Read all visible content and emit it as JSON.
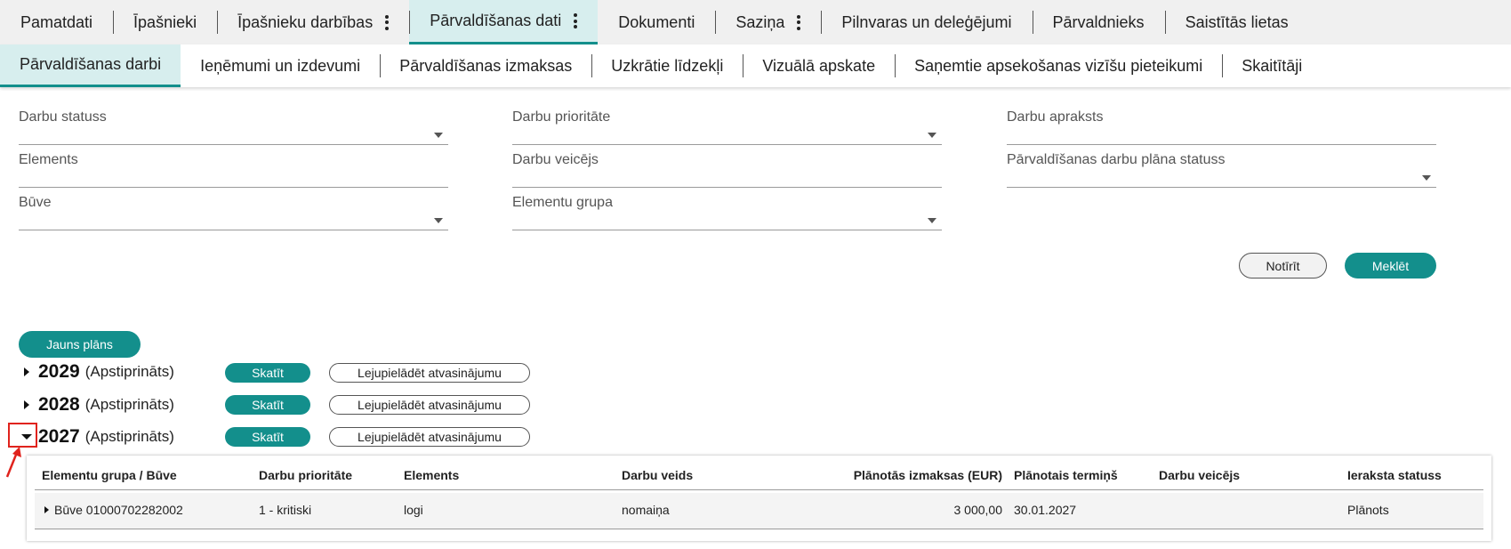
{
  "top_tabs": [
    {
      "label": "Pamatdati",
      "menu": false,
      "active": false
    },
    {
      "label": "Īpašnieki",
      "menu": false,
      "active": false
    },
    {
      "label": "Īpašnieku darbības",
      "menu": true,
      "active": false
    },
    {
      "label": "Pārvaldīšanas dati",
      "menu": true,
      "active": true
    },
    {
      "label": "Dokumenti",
      "menu": false,
      "active": false
    },
    {
      "label": "Saziņa",
      "menu": true,
      "active": false
    },
    {
      "label": "Pilnvaras un deleģējumi",
      "menu": false,
      "active": false
    },
    {
      "label": "Pārvaldnieks",
      "menu": false,
      "active": false
    },
    {
      "label": "Saistītās lietas",
      "menu": false,
      "active": false
    }
  ],
  "sub_tabs": [
    {
      "label": "Pārvaldīšanas darbi",
      "active": true
    },
    {
      "label": "Ieņēmumi un izdevumi",
      "active": false
    },
    {
      "label": "Pārvaldīšanas izmaksas",
      "active": false
    },
    {
      "label": "Uzkrātie līdzekļi",
      "active": false
    },
    {
      "label": "Vizuālā apskate",
      "active": false
    },
    {
      "label": "Saņemtie apsekošanas vizīšu pieteikumi",
      "active": false
    },
    {
      "label": "Skaitītāji",
      "active": false
    }
  ],
  "filters": {
    "darbu_statuss": "Darbu statuss",
    "darbu_prioritate": "Darbu prioritāte",
    "darbu_apraksts": "Darbu apraksts",
    "elements": "Elements",
    "darbu_veicejs": "Darbu veicējs",
    "plana_statuss": "Pārvaldīšanas darbu plāna statuss",
    "buve": "Būve",
    "elementu_grupa": "Elementu grupa"
  },
  "actions": {
    "clear": "Notīrīt",
    "search": "Meklēt",
    "new_plan": "Jauns plāns"
  },
  "plans": [
    {
      "year": "2029",
      "status": "(Apstiprināts)",
      "view": "Skatīt",
      "download": "Lejupielādēt atvasinājumu",
      "expanded": false
    },
    {
      "year": "2028",
      "status": "(Apstiprināts)",
      "view": "Skatīt",
      "download": "Lejupielādēt atvasinājumu",
      "expanded": false
    },
    {
      "year": "2027",
      "status": "(Apstiprināts)",
      "view": "Skatīt",
      "download": "Lejupielādēt atvasinājumu",
      "expanded": true
    }
  ],
  "table": {
    "headers": {
      "group": "Elementu grupa / Būve",
      "priority": "Darbu prioritāte",
      "elements": "Elements",
      "work_type": "Darbu veids",
      "cost": "Plānotās izmaksas (EUR)",
      "deadline": "Plānotais termiņš",
      "performer": "Darbu veicējs",
      "status": "Ieraksta statuss"
    },
    "rows": [
      {
        "group": "Būve 01000702282002",
        "priority": "1 - kritiski",
        "elements": "logi",
        "work_type": "nomaiņa",
        "cost": "3 000,00",
        "deadline": "30.01.2027",
        "performer": "",
        "status": "Plānots"
      }
    ]
  },
  "colors": {
    "accent": "#138f8c",
    "active_tab_bg": "#d7eeee",
    "annotation": "#e0231d"
  }
}
